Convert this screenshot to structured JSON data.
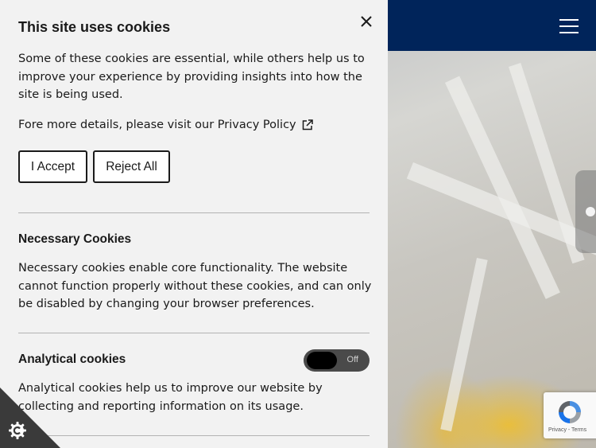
{
  "cookie_panel": {
    "title": "This site uses cookies",
    "intro": "Some of these cookies are essential, while others help us to improve your experience by providing insights into how the site is being used.",
    "details_text": "Fore more details, please visit our Privacy Policy",
    "accept_label": "I Accept",
    "reject_label": "Reject All",
    "necessary": {
      "title": "Necessary Cookies",
      "description": "Necessary cookies enable core functionality. The website cannot function properly without these cookies, and can only be disabled by changing your browser preferences."
    },
    "analytical": {
      "title": "Analytical cookies",
      "description": "Analytical cookies help us to improve our website by collecting and reporting information on its usage.",
      "toggle_state": "Off"
    }
  },
  "recaptcha": {
    "text": "Privacy - Terms"
  },
  "colors": {
    "header_bg": "#00245a",
    "panel_bg": "#f2f2f2",
    "toggle_bg": "#4a4a4a",
    "badge_bg": "#3a3a3a"
  },
  "icons": [
    "close-icon",
    "external-link-icon",
    "hamburger-menu-icon",
    "cookie-settings-icon",
    "recaptcha-logo-icon"
  ]
}
